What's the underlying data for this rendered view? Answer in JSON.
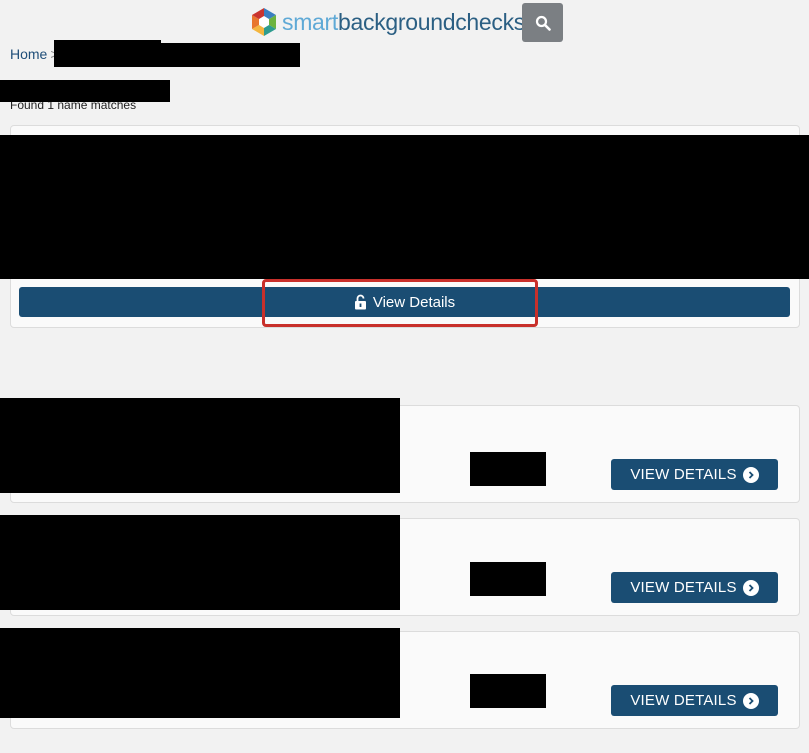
{
  "header": {
    "logo_smart": "smart",
    "logo_rest": "backgroundchecks",
    "search_icon": "search-icon"
  },
  "breadcrumb": {
    "home": "Home",
    "separator": ">"
  },
  "results": {
    "found_text": "Found 1 name matches"
  },
  "main_card": {
    "button_label": "View Details",
    "button_icon": "unlock-icon"
  },
  "other_cards": [
    {
      "button_label": "VIEW DETAILS",
      "button_icon": "chevron-right-circle-icon"
    },
    {
      "button_label": "VIEW DETAILS",
      "button_icon": "chevron-right-circle-icon"
    },
    {
      "button_label": "VIEW DETAILS",
      "button_icon": "chevron-right-circle-icon"
    }
  ],
  "colors": {
    "background": "#f2f2f2",
    "primary_button": "#1a4d73",
    "search_button": "#7b7f83",
    "highlight": "#c8302b",
    "logo_light": "#5fa9d6",
    "logo_dark": "#2b5f83"
  }
}
